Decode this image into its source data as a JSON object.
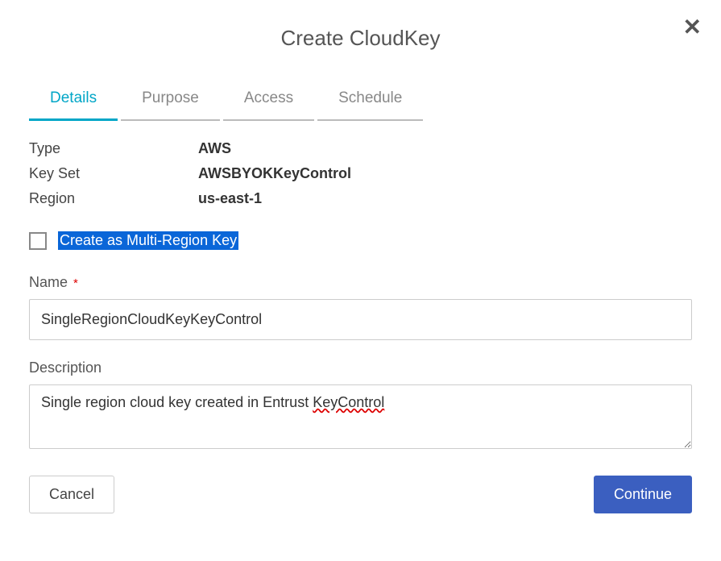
{
  "dialog": {
    "title": "Create CloudKey",
    "close_glyph": "✕"
  },
  "tabs": [
    {
      "label": "Details",
      "active": true
    },
    {
      "label": "Purpose",
      "active": false
    },
    {
      "label": "Access",
      "active": false
    },
    {
      "label": "Schedule",
      "active": false
    }
  ],
  "details": {
    "type_label": "Type",
    "type_value": "AWS",
    "keyset_label": "Key Set",
    "keyset_value": "AWSBYOKKeyControl",
    "region_label": "Region",
    "region_value": "us-east-1"
  },
  "multiregion": {
    "checked": false,
    "label": "Create as Multi-Region Key"
  },
  "name": {
    "label": "Name",
    "required_mark": "*",
    "value": "SingleRegionCloudKeyKeyControl"
  },
  "description": {
    "label": "Description",
    "value_plain": "Single region cloud key created in Entrust KeyControl",
    "value_prefix": "Single region cloud key created in Entrust ",
    "value_misspelled": "KeyControl"
  },
  "buttons": {
    "cancel": "Cancel",
    "continue": "Continue"
  }
}
